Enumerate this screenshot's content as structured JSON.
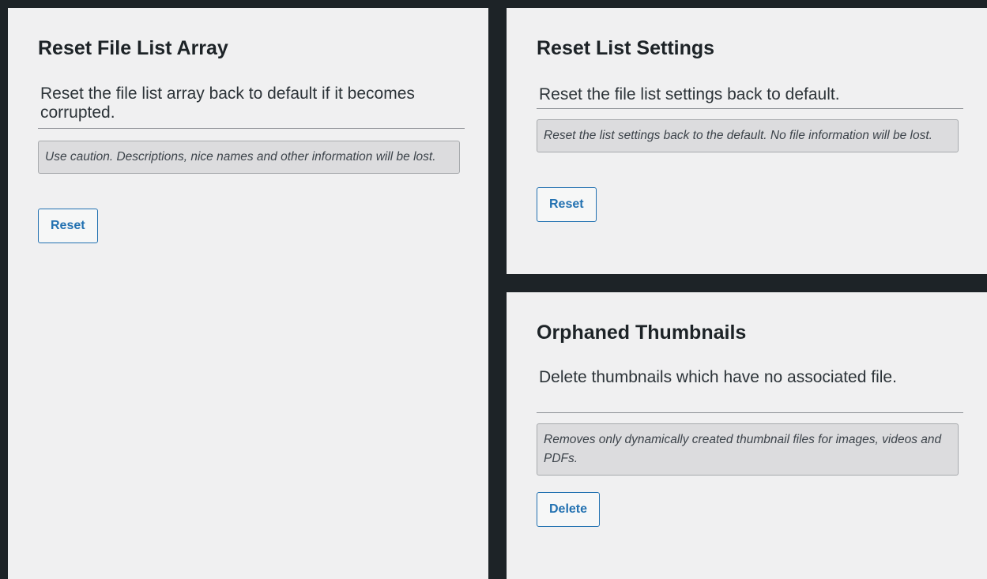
{
  "reset_file_list": {
    "title": "Reset File List Array",
    "description": "Reset the file list array back to default if it becomes corrupted.",
    "note": "Use caution. Descriptions, nice names and other information will be lost.",
    "button_label": "Reset"
  },
  "reset_list_settings": {
    "title": "Reset List Settings",
    "description": "Reset the file list settings back to default.",
    "note": "Reset the list settings back to the default. No file information will be lost.",
    "button_label": "Reset"
  },
  "orphaned_thumbnails": {
    "title": "Orphaned Thumbnails",
    "description": "Delete thumbnails which have no associated file.",
    "note": "Removes only dynamically created thumbnail files for images, videos and PDFs.",
    "button_label": "Delete"
  }
}
